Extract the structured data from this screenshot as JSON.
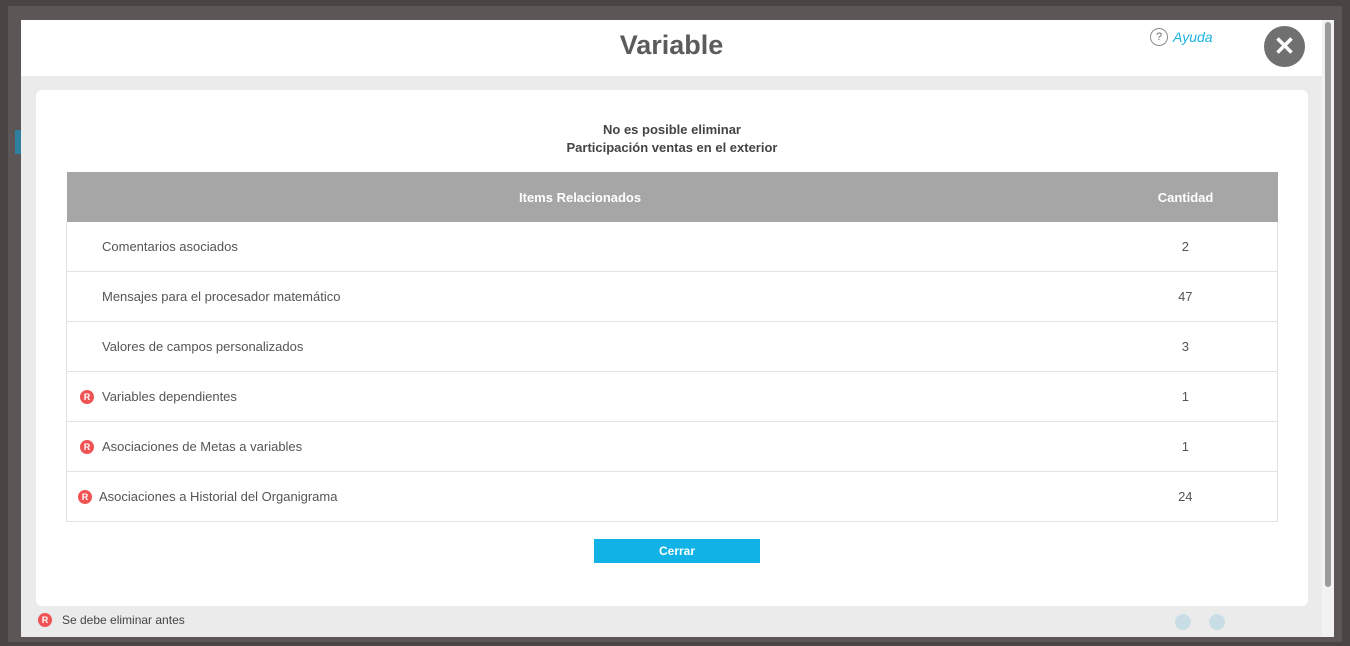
{
  "modal": {
    "title": "Variable",
    "help_label": "Ayuda",
    "help_icon": "?",
    "close_icon": "✕"
  },
  "message": {
    "line1": "No es posible eliminar",
    "line2": "Participación ventas en el exterior"
  },
  "table": {
    "headers": {
      "item": "Items Relacionados",
      "qty": "Cantidad"
    },
    "rows": [
      {
        "label": "Comentarios asociados",
        "qty": "2",
        "required": false
      },
      {
        "label": "Mensajes para el procesador matemático",
        "qty": "47",
        "required": false
      },
      {
        "label": "Valores de campos personalizados",
        "qty": "3",
        "required": false
      },
      {
        "label": "Variables dependientes",
        "qty": "1",
        "required": true
      },
      {
        "label": "Asociaciones de Metas a variables",
        "qty": "1",
        "required": true
      },
      {
        "label": "Asociaciones a Historial del Organigrama",
        "qty": "24",
        "required": true
      }
    ]
  },
  "badge_letter": "R",
  "buttons": {
    "close_label": "Cerrar"
  },
  "legend": {
    "text": "Se debe eliminar antes"
  },
  "colors": {
    "accent": "#11b3e6",
    "badge": "#ef5353",
    "header": "#a6a6a6"
  }
}
